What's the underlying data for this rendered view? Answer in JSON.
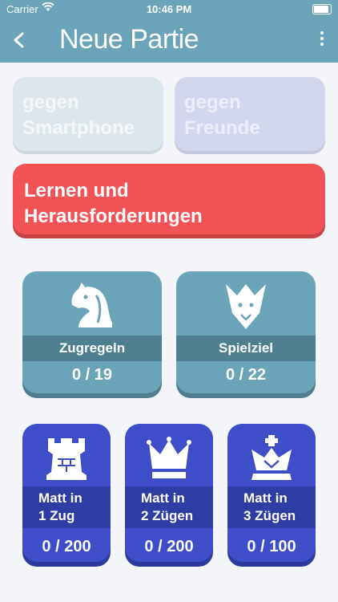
{
  "status": {
    "carrier": "Carrier",
    "time": "10:46 PM"
  },
  "nav": {
    "title": "Neue Partie"
  },
  "modes": {
    "smartphone": [
      "gegen",
      "Smartphone"
    ],
    "friends": [
      "gegen",
      "Freunde"
    ],
    "learn": [
      "Lernen und",
      "Herausforderungen"
    ]
  },
  "categories": [
    {
      "label": "Zugregeln",
      "score": "0 / 19",
      "icon": "knight-icon"
    },
    {
      "label": "Spielziel",
      "score": "0 / 22",
      "icon": "king-face-icon"
    }
  ],
  "mates": [
    {
      "line1": "Matt in",
      "line2": "1 Zug",
      "score": "0 / 200",
      "icon": "rook-icon"
    },
    {
      "line1": "Matt in",
      "line2": "2 Zügen",
      "score": "0 / 200",
      "icon": "crown-icon"
    },
    {
      "line1": "Matt in",
      "line2": "3 Zügen",
      "score": "0 / 100",
      "icon": "king-icon"
    }
  ],
  "colors": {
    "header": "#6aa4b8",
    "learn": "#f25354",
    "category": "#6aa4b8",
    "mate": "#3e4ec8"
  }
}
